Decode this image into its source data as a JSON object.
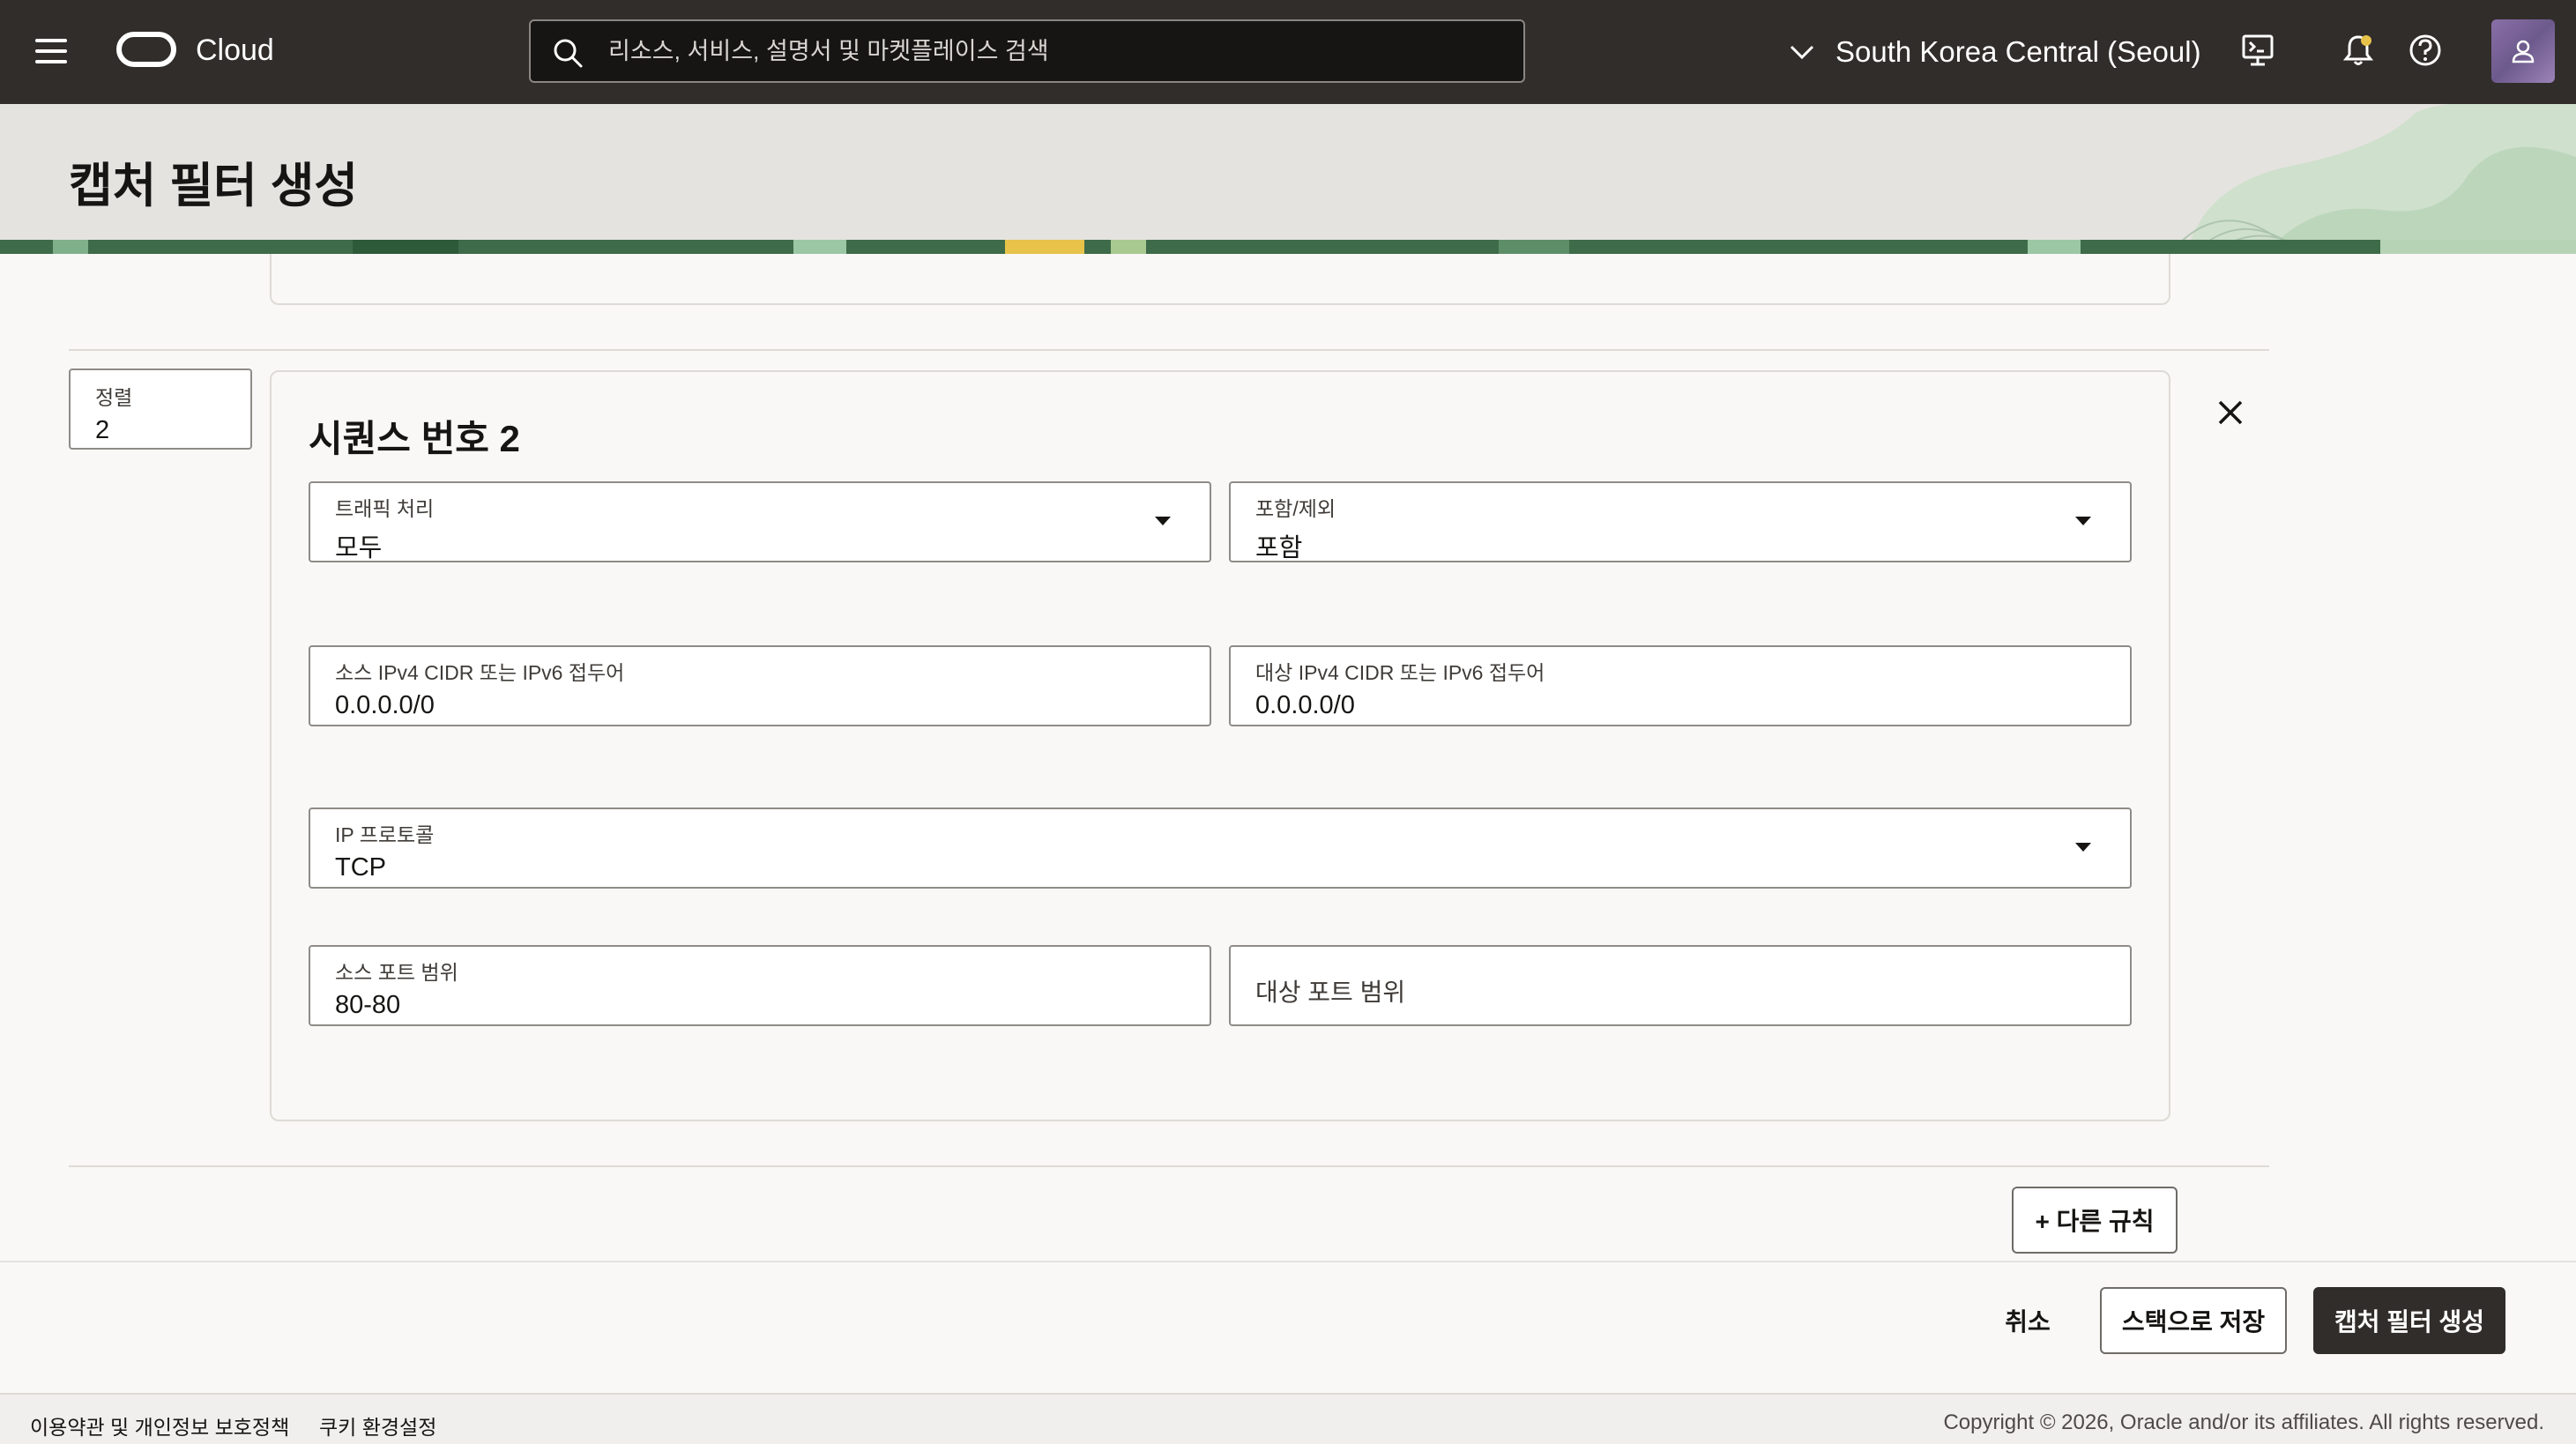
{
  "topbar": {
    "brand": "Cloud",
    "search_placeholder": "리소스, 서비스, 설명서 및 마켓플레이스 검색",
    "region": "South Korea Central (Seoul)",
    "icons": [
      "menu-icon",
      "oracle-logo-icon",
      "search-icon",
      "chevron-down-icon",
      "cloud-shell-icon",
      "bell-icon",
      "help-icon",
      "user-icon"
    ]
  },
  "page": {
    "title": "캡처 필터 생성"
  },
  "rule": {
    "order_label": "정렬",
    "order_value": "2",
    "title": "시퀀스 번호 2",
    "traffic_label": "트래픽 처리",
    "traffic_value": "모두",
    "include_label": "포함/제외",
    "include_value": "포함",
    "source_cidr_label": "소스 IPv4 CIDR 또는 IPv6 접두어",
    "source_cidr_value": "0.0.0.0/0",
    "dest_cidr_label": "대상 IPv4 CIDR 또는 IPv6 접두어",
    "dest_cidr_value": "0.0.0.0/0",
    "protocol_label": "IP 프로토콜",
    "protocol_value": "TCP",
    "source_port_label": "소스 포트 범위",
    "source_port_value": "80-80",
    "dest_port_label": "대상 포트 범위"
  },
  "actions": {
    "add_rule": "+ 다른 규칙",
    "cancel": "취소",
    "save_stack": "스택으로 저장",
    "create": "캡처 필터 생성"
  },
  "footer": {
    "terms": "이용약관 및 개인정보 보호정책",
    "cookies": "쿠키 환경설정",
    "copyright": "Copyright © 2026, Oracle and/or its affiliates. All rights reserved."
  },
  "colors": {
    "topbar": "#312d2a",
    "header_band": "#e5e3df",
    "primary_button": "#312d2a",
    "accent_green": "#6aa57a",
    "accent_yellow": "#e7c34a"
  }
}
